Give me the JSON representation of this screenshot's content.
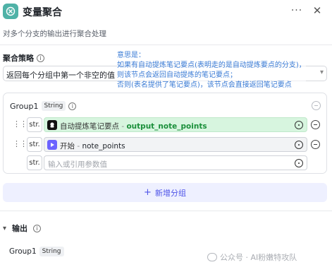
{
  "header": {
    "title": "变量聚合",
    "more_label": "···",
    "close_label": "✕",
    "description": "对多个分支的输出进行聚合处理"
  },
  "strategy": {
    "label": "聚合策略",
    "info_icon": "i",
    "value": "返回每个分组中第一个非空的值"
  },
  "annotation": {
    "lines": [
      "意思是：",
      "如果有自动提炼笔记要点(表明走的是自动提炼要点的分支)，",
      "则该节点会返回自动提炼的笔记要点；",
      "否则(表名提供了笔记要点)，该节点会直接返回笔记要点"
    ]
  },
  "group": {
    "name": "Group1",
    "type_tag": "String",
    "info_icon": "i",
    "rows": [
      {
        "type": "str.",
        "source": "自动提炼笔记要点",
        "sep": " - ",
        "variable": "output_note_points"
      },
      {
        "type": "str.",
        "source": "开始",
        "sep": " - ",
        "variable": "note_points"
      },
      {
        "type": "str.",
        "placeholder": "输入或引用参数值"
      }
    ]
  },
  "add_group": {
    "plus": "+",
    "label": "新增分组"
  },
  "output": {
    "label": "输出",
    "info_icon": "i",
    "item_name": "Group1",
    "item_type": "String"
  },
  "watermark": {
    "text": "公众号 · AI粉嫩特攻队"
  },
  "colors": {
    "accent": "#4d53e8",
    "annotation": "#3a7bd5",
    "highlight": "#d7f5df"
  }
}
